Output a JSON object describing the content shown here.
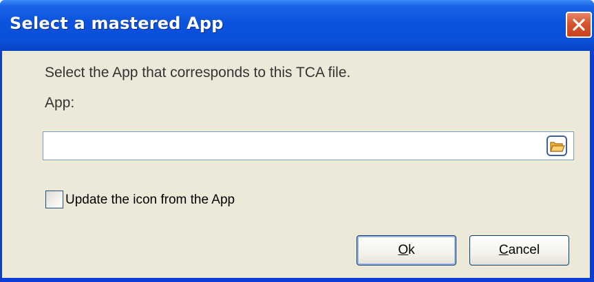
{
  "window": {
    "title": "Select a mastered App"
  },
  "dialog": {
    "prompt": "Select the App that corresponds to this TCA file.",
    "app_label": "App:",
    "app_path_value": "",
    "browse_icon": "folder-open-icon",
    "checkbox_label": "Update the icon from the App",
    "checkbox_checked": false,
    "ok_accesskey": "O",
    "ok_rest": "k",
    "cancel_accesskey": "C",
    "cancel_rest": "ancel"
  },
  "colors": {
    "titlebar": "#0a4fd8",
    "client_bg": "#ece9d8",
    "close_button": "#d6562f"
  }
}
